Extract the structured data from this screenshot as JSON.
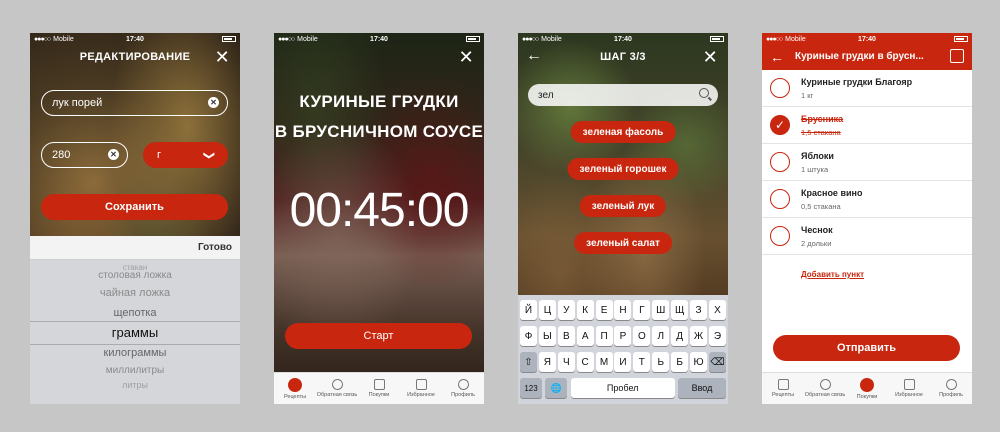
{
  "status": {
    "carrier": "Mobile",
    "time": "17:40",
    "signal_dots": "●●●○○"
  },
  "colors": {
    "accent": "#c8260e",
    "keyboard": "#d1d5db",
    "picker": "#d4d6da"
  },
  "screen1": {
    "title": "РЕДАКТИРОВАНИЕ",
    "close_icon": "✕",
    "name_value": "лук порей",
    "amount_value": "280",
    "unit_value": "г",
    "clear_icon": "✕",
    "chevron_icon": "❯",
    "save_label": "Сохранить",
    "done_label": "Готово",
    "picker_options": [
      "стакан",
      "столовая ложка",
      "чайная ложка",
      "щепотка",
      "граммы",
      "килограммы",
      "миллилитры",
      "литры"
    ],
    "picker_selected": "граммы"
  },
  "screen2": {
    "title_line1": "КУРИНЫЕ ГРУДКИ",
    "title_line2": "В БРУСНИЧНОМ СОУСЕ",
    "timer": "00:45:00",
    "start_label": "Старт",
    "tabs": [
      "Рецепты",
      "Обратная связь",
      "Покупки",
      "Избранное",
      "Профиль"
    ],
    "active_tab": "Рецепты"
  },
  "screen3": {
    "title": "ШАГ 3/3",
    "back_icon": "←",
    "close_icon": "✕",
    "search_value": "зел",
    "suggestions": [
      "зеленая фасоль",
      "зеленый горошек",
      "зеленый лук",
      "зеленый салат"
    ],
    "keyboard_rows": [
      [
        "Й",
        "Ц",
        "У",
        "К",
        "Е",
        "Н",
        "Г",
        "Ш",
        "Щ",
        "З",
        "Х"
      ],
      [
        "Ф",
        "Ы",
        "В",
        "А",
        "П",
        "Р",
        "О",
        "Л",
        "Д",
        "Ж",
        "Э"
      ],
      [
        "⇧",
        "Я",
        "Ч",
        "С",
        "М",
        "И",
        "Т",
        "Ь",
        "Б",
        "Ю",
        "⌫"
      ]
    ],
    "key_123": "123",
    "key_globe": "🌐",
    "key_space": "Пробел",
    "key_enter": "Ввод"
  },
  "screen4": {
    "title": "Куриные грудки в брусн...",
    "back_icon": "←",
    "items": [
      {
        "name": "Куриные грудки Благояр",
        "qty": "1 кг",
        "checked": false
      },
      {
        "name": "Брусника",
        "qty": "1,5 стакана",
        "checked": true
      },
      {
        "name": "Яблоки",
        "qty": "1 штука",
        "checked": false
      },
      {
        "name": "Красное вино",
        "qty": "0,5 стакана",
        "checked": false
      },
      {
        "name": "Чеснок",
        "qty": "2 дольки",
        "checked": false
      }
    ],
    "add_label": "Добавить пункт",
    "send_label": "Отправить",
    "tabs": [
      "Рецепты",
      "Обратная связь",
      "Покупки",
      "Избранное",
      "Профиль"
    ],
    "active_tab": "Покупки"
  }
}
